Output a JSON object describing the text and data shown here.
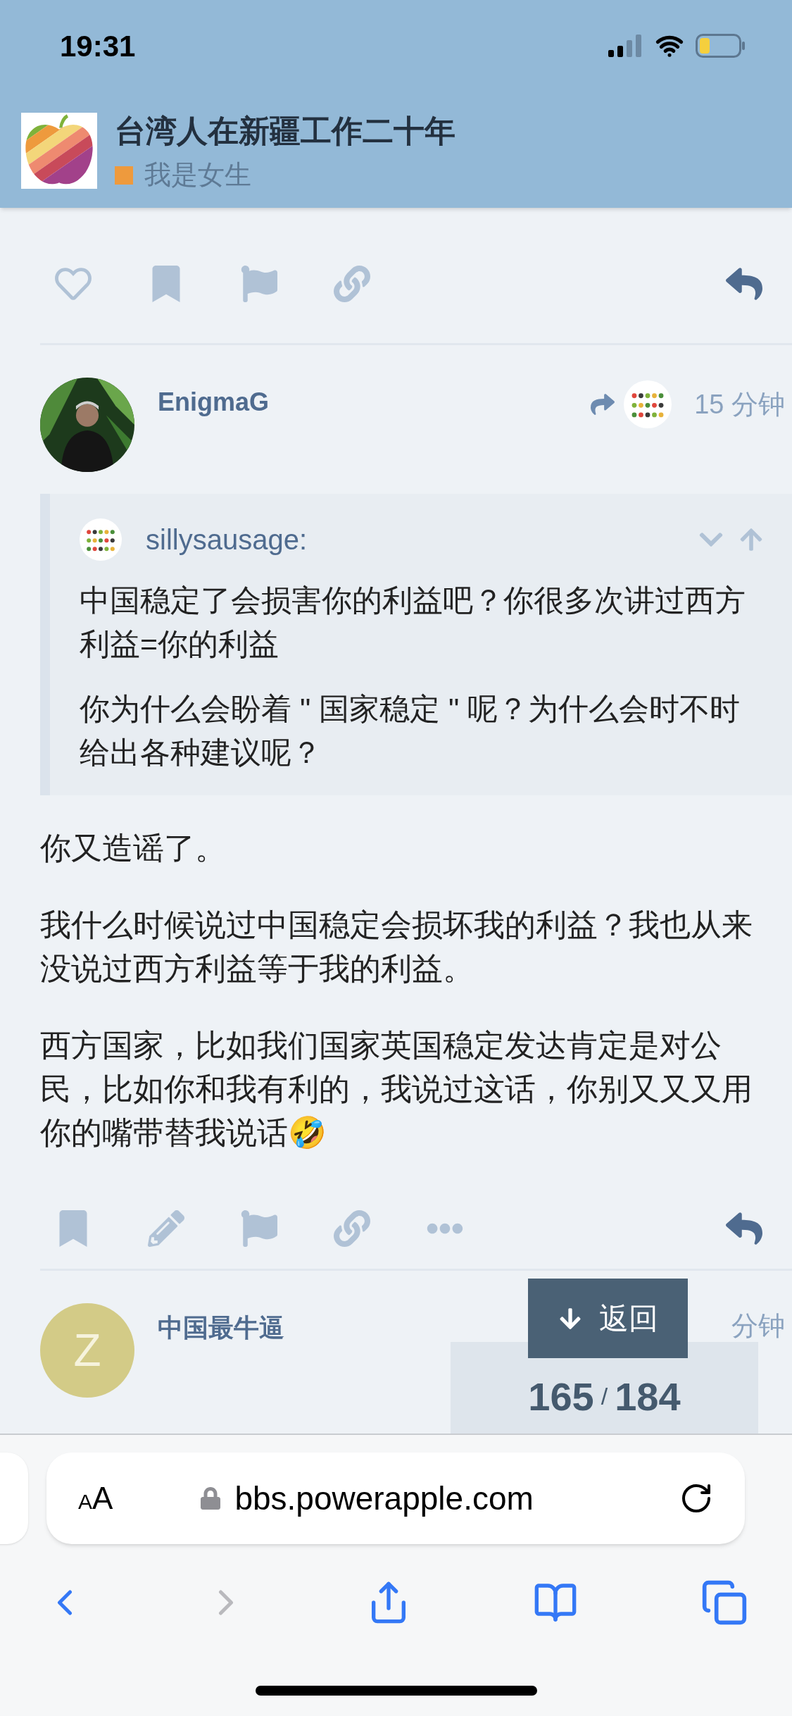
{
  "status_bar": {
    "time": "19:31"
  },
  "topic": {
    "title": "台湾人在新疆工作二十年",
    "category": {
      "name": "我是女生",
      "color": "#ee9a3d"
    }
  },
  "top_actions": [
    {
      "kind": "like"
    },
    {
      "kind": "bookmark"
    },
    {
      "kind": "flag"
    },
    {
      "kind": "link"
    },
    {
      "kind": "reply"
    }
  ],
  "posts": [
    {
      "author": "EnigmaG",
      "avatar": {
        "kind": "picture"
      },
      "reply_to": {
        "avatar": {
          "kind": "picture"
        }
      },
      "time": "15 分钟",
      "quote": {
        "author": "sillysausage:",
        "paragraphs": [
          "中国稳定了会损害你的利益吧？你很多次讲过西方利益=你的利益",
          "你为什么会盼着 \" 国家稳定 \" 呢？为什么会时不时给出各种建议呢？"
        ]
      },
      "paragraphs": [
        "你又造谣了。",
        "我什么时候说过中国稳定会损坏我的利益？我也从来没说过西方利益等于我的利益。",
        "西方国家，比如我们国家英国稳定发达肯定是对公民，比如你和我有利的，我说过这话，你别又又又用你的嘴带替我说话🤣"
      ],
      "actions": [
        {
          "kind": "bookmark"
        },
        {
          "kind": "edit"
        },
        {
          "kind": "flag"
        },
        {
          "kind": "link"
        },
        {
          "kind": "more"
        },
        {
          "kind": "reply"
        }
      ]
    },
    {
      "author": "中国最牛逼",
      "avatar": {
        "kind": "letter",
        "letter": "Z",
        "color": "#d3cb87"
      },
      "time": "分钟"
    }
  ],
  "progress": {
    "jump_button": "返回",
    "current": "165",
    "separator": "/",
    "total": "184"
  },
  "browser": {
    "text_size": [
      "A",
      "A"
    ],
    "url": "bbs.powerapple.com",
    "back_enabled": true,
    "forward_enabled": false
  }
}
